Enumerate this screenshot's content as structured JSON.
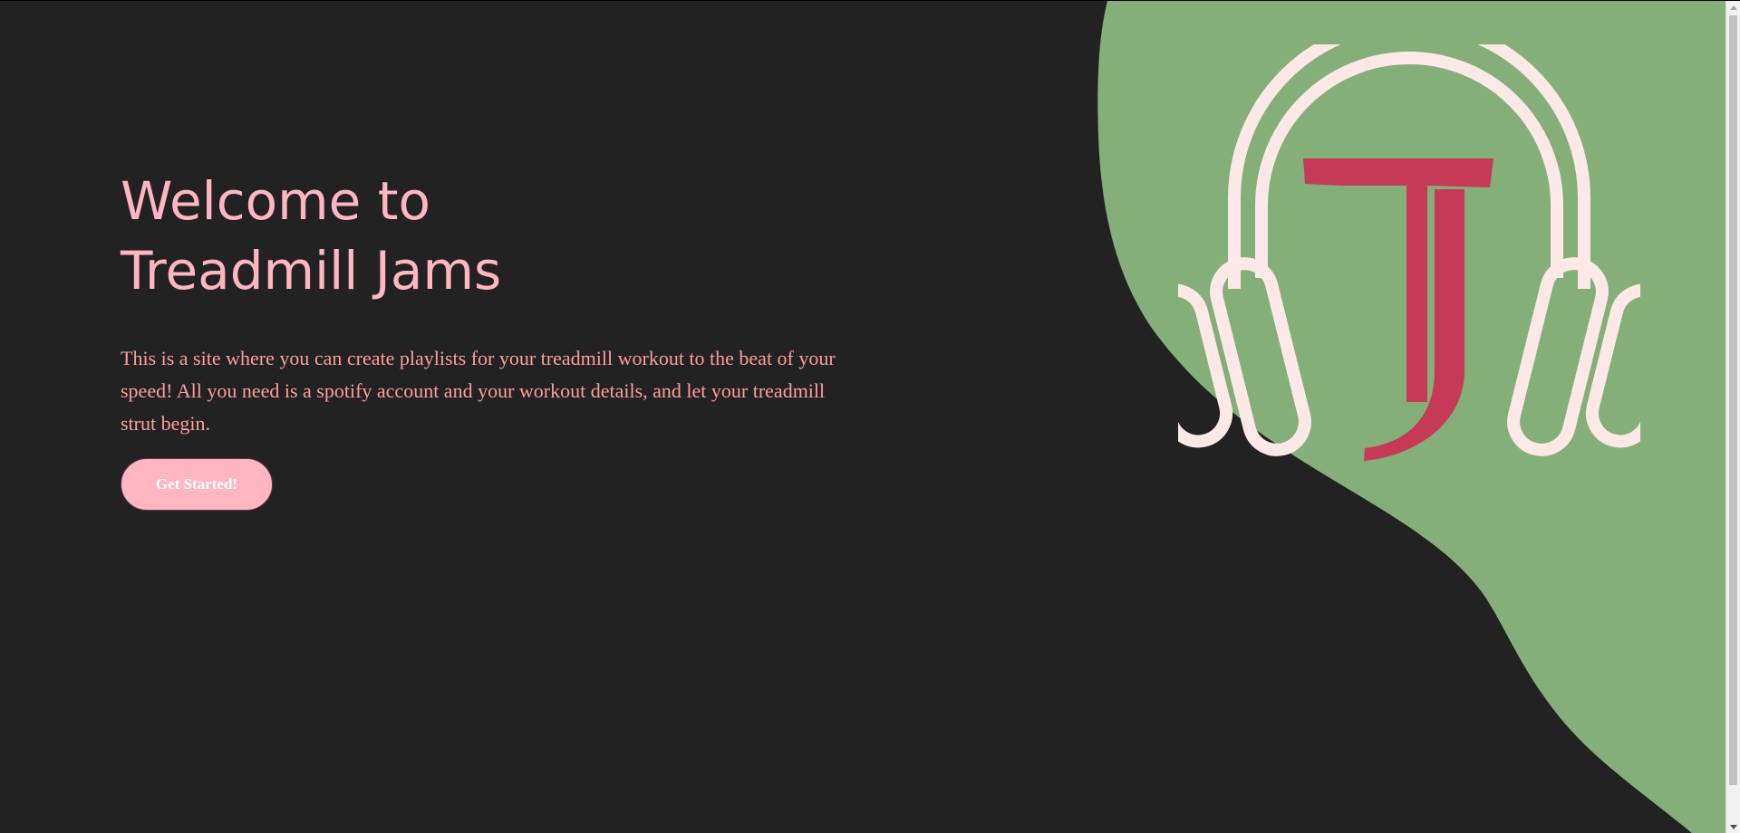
{
  "hero": {
    "title_line1": "Welcome to",
    "title_line2": "Treadmill Jams",
    "description": "This is a site where you can create playlists for your treadmill workout to the beat of your speed! All you need is a spotify account and your workout details, and let your treadmill strut begin.",
    "cta_label": "Get Started!"
  },
  "logo": {
    "icon": "headphones-tj-logo",
    "monogram": "TJ"
  },
  "colors": {
    "background": "#222222",
    "blob": "#84af78",
    "heading": "#ffb6c1",
    "description": "#ff9d9d",
    "button": "#ffb6c1",
    "headphones": "#fde8e8",
    "monogram": "#c53a57"
  }
}
